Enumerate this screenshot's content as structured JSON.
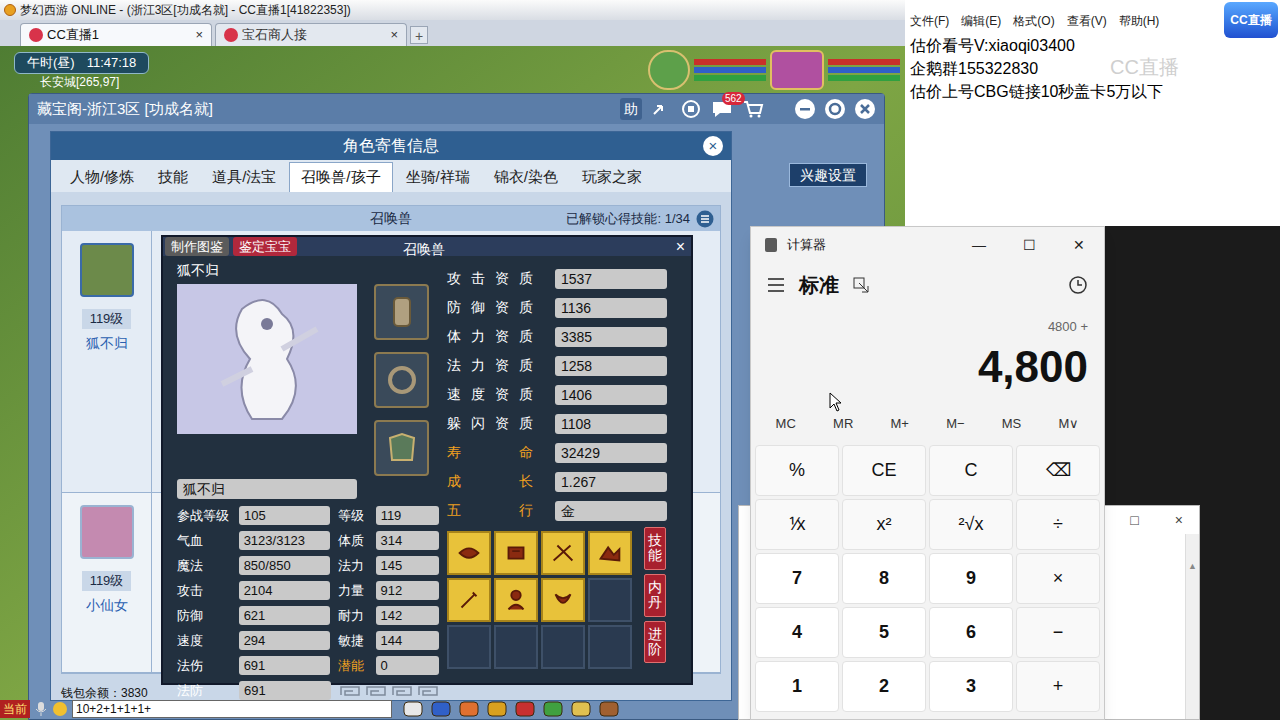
{
  "browser": {
    "title": "梦幻西游 ONLINE - (浙江3区[功成名就] - CC直播1[41822353])",
    "tabs": [
      {
        "label": "CC直播1",
        "close": "×",
        "selected": true
      },
      {
        "label": "宝石商人接",
        "close": "×",
        "selected": false
      }
    ],
    "new_tab": "+"
  },
  "hud": {
    "period": "午时(昼)",
    "clock": "11:47:18",
    "location": "长安城[265,97]"
  },
  "cbg": {
    "title": "藏宝阁-浙江3区 [功成名就]",
    "help": "助",
    "badge": "562",
    "interest_button": "兴趣设置"
  },
  "sale_panel": {
    "title": "角色寄售信息",
    "close": "×",
    "tabs": [
      {
        "label": "人物/修炼",
        "selected": false
      },
      {
        "label": "技能",
        "selected": false
      },
      {
        "label": "道具/法宝",
        "selected": false
      },
      {
        "label": "召唤兽/孩子",
        "selected": true
      },
      {
        "label": "坐骑/祥瑞",
        "selected": false
      },
      {
        "label": "锦衣/染色",
        "selected": false
      },
      {
        "label": "玩家之家",
        "selected": false
      }
    ],
    "section": "召唤兽",
    "unlock": "已解锁心得技能: 1/34",
    "pets": [
      {
        "level": "119级",
        "name": "狐不归",
        "selected": true
      },
      {
        "level": "119级",
        "name": "小仙女",
        "selected": false
      }
    ],
    "wallet": "钱包余额：3830"
  },
  "pet_card": {
    "buttons": [
      {
        "label": "制作图鉴",
        "color": "#5b5b5b"
      },
      {
        "label": "鉴定宝宝",
        "color": "#b1283c"
      }
    ],
    "title": "召唤兽",
    "close": "×",
    "name": "狐不归",
    "name_field": "狐不归",
    "qualities": [
      {
        "label": "攻 击 资 质",
        "value": "1537",
        "highlight": false
      },
      {
        "label": "防 御 资 质",
        "value": "1136",
        "highlight": false
      },
      {
        "label": "体 力 资 质",
        "value": "3385",
        "highlight": false
      },
      {
        "label": "法 力 资 质",
        "value": "1258",
        "highlight": false
      },
      {
        "label": "速 度 资 质",
        "value": "1406",
        "highlight": false
      },
      {
        "label": "躲 闪 资 质",
        "value": "1108",
        "highlight": false
      },
      {
        "label": "寿 命",
        "value": "32429",
        "highlight": true
      },
      {
        "label": "成 长",
        "value": "1.267",
        "highlight": true
      },
      {
        "label": "五 行",
        "value": "金",
        "highlight": true
      }
    ],
    "stats": [
      {
        "label": "参战等级",
        "value": "105",
        "label2": "等级",
        "value2": "119",
        "highlight2": false
      },
      {
        "label": "气血",
        "value": "3123/3123",
        "label2": "体质",
        "value2": "314",
        "highlight2": false
      },
      {
        "label": "魔法",
        "value": "850/850",
        "label2": "法力",
        "value2": "145",
        "highlight2": false
      },
      {
        "label": "攻击",
        "value": "2104",
        "label2": "力量",
        "value2": "912",
        "highlight2": false
      },
      {
        "label": "防御",
        "value": "621",
        "label2": "耐力",
        "value2": "142",
        "highlight2": false
      },
      {
        "label": "速度",
        "value": "294",
        "label2": "敏捷",
        "value2": "144",
        "highlight2": false
      },
      {
        "label": "法伤",
        "value": "691",
        "label2": "潜能",
        "value2": "0",
        "highlight2": true
      }
    ],
    "last_stat": {
      "label": "法防",
      "value": "691"
    },
    "skills": [
      {
        "filled": true
      },
      {
        "filled": true
      },
      {
        "filled": true
      },
      {
        "filled": true
      },
      {
        "filled": true
      },
      {
        "filled": true
      },
      {
        "filled": true
      },
      {
        "filled": false
      },
      {
        "filled": false
      },
      {
        "filled": false
      },
      {
        "filled": false
      },
      {
        "filled": false
      }
    ],
    "side_buttons": [
      "技能",
      "内丹",
      "进阶"
    ]
  },
  "chat": {
    "channel": "当前",
    "input": "10+2+1+1+1+"
  },
  "notepad": {
    "menu": [
      "文件(F)",
      "编辑(E)",
      "格式(O)",
      "查看(V)",
      "帮助(H)"
    ],
    "lines": [
      "估价看号V:xiaoqi03400",
      "企鹅群155322830",
      "估价上号CBG链接10秒盖卡5万以下"
    ]
  },
  "stream": {
    "logo": "CC直播",
    "watermark": "CC直播"
  },
  "calculator": {
    "title": "计算器",
    "controls": [
      "—",
      "☐",
      "✕"
    ],
    "mode": "标准",
    "expression": "4800 +",
    "display": "4,800",
    "memory": [
      "MC",
      "MR",
      "M+",
      "M−",
      "MS",
      "M∨"
    ],
    "keys": [
      {
        "label": "%",
        "kind": "function"
      },
      {
        "label": "CE",
        "kind": "function"
      },
      {
        "label": "C",
        "kind": "function"
      },
      {
        "label": "⌫",
        "kind": "function"
      },
      {
        "label": "⅟x",
        "kind": "function"
      },
      {
        "label": "x²",
        "kind": "function"
      },
      {
        "label": "²√x",
        "kind": "function"
      },
      {
        "label": "÷",
        "kind": "function"
      },
      {
        "label": "7",
        "kind": "number"
      },
      {
        "label": "8",
        "kind": "number"
      },
      {
        "label": "9",
        "kind": "number"
      },
      {
        "label": "×",
        "kind": "function"
      },
      {
        "label": "4",
        "kind": "number"
      },
      {
        "label": "5",
        "kind": "number"
      },
      {
        "label": "6",
        "kind": "number"
      },
      {
        "label": "−",
        "kind": "function"
      },
      {
        "label": "1",
        "kind": "number"
      },
      {
        "label": "2",
        "kind": "number"
      },
      {
        "label": "3",
        "kind": "number"
      },
      {
        "label": "+",
        "kind": "function"
      }
    ]
  },
  "back_window": {
    "maximize": "□",
    "close": "×",
    "scroll_up": "▲"
  }
}
